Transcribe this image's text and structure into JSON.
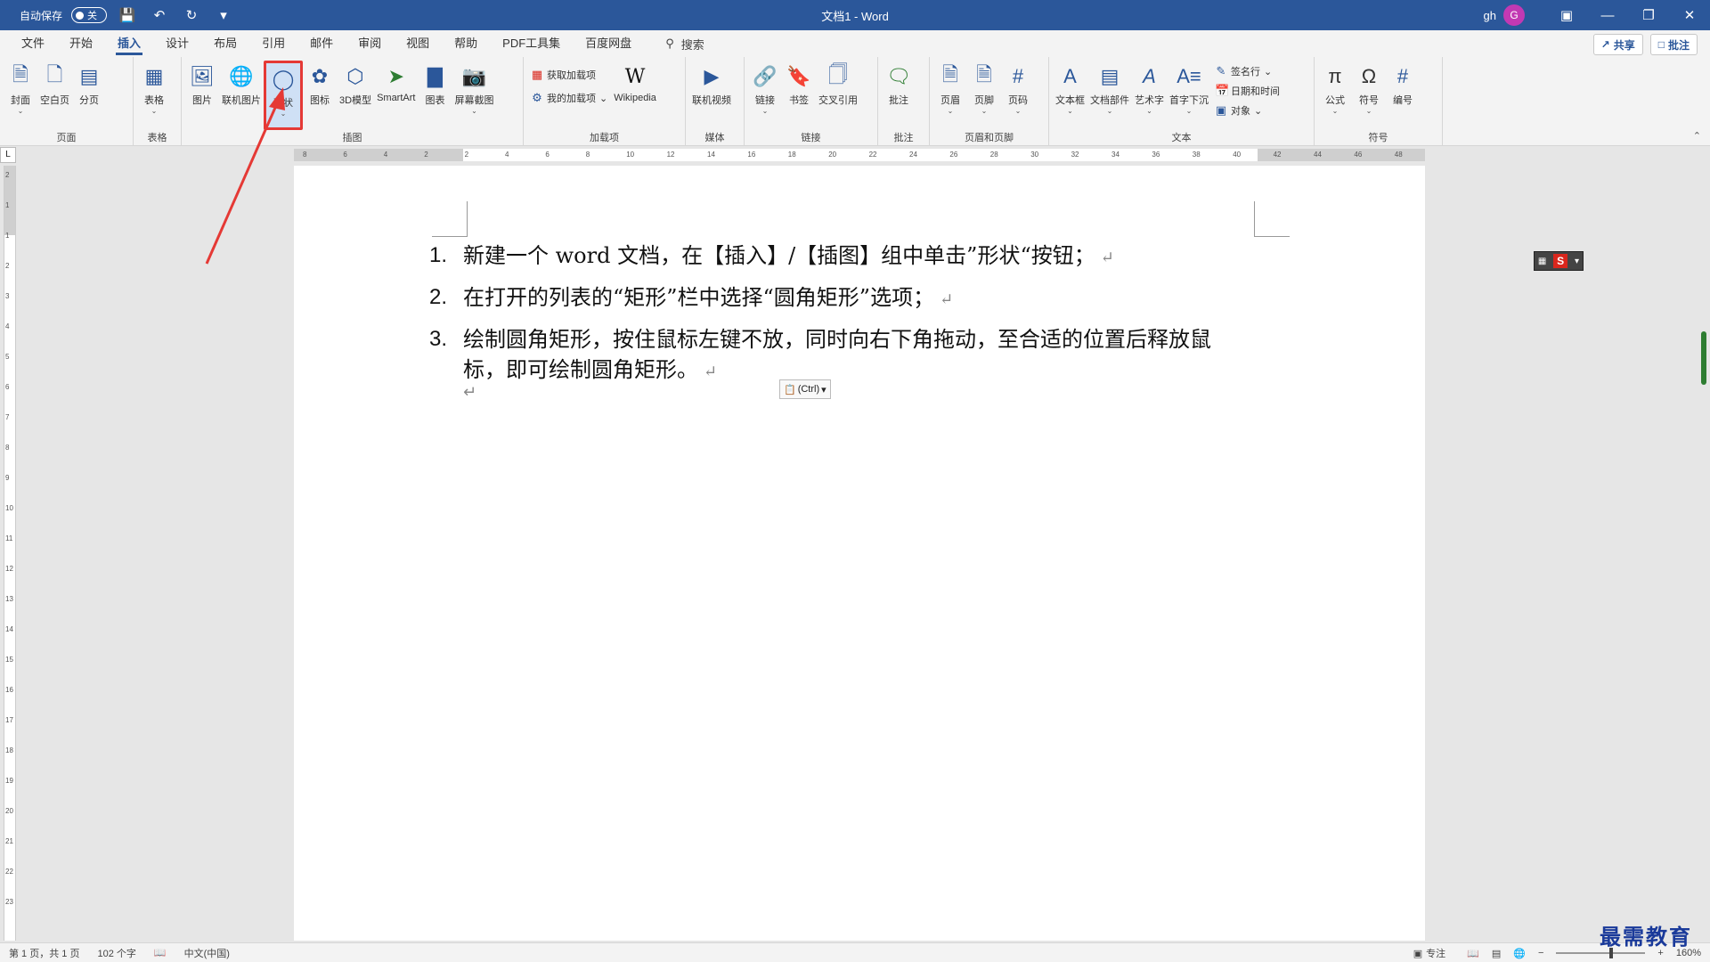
{
  "titlebar": {
    "autosave_label": "自动保存",
    "autosave_state": "关",
    "title": "文档1 - Word",
    "user": "gh",
    "avatar_letter": "G"
  },
  "menubar": {
    "tabs": [
      "文件",
      "开始",
      "插入",
      "设计",
      "布局",
      "引用",
      "邮件",
      "审阅",
      "视图",
      "帮助",
      "PDF工具集",
      "百度网盘"
    ],
    "active_tab": "插入",
    "search_label": "搜索",
    "share_label": "共享",
    "comment_label": "批注"
  },
  "ribbon": {
    "groups": {
      "pages": {
        "label": "页面",
        "buttons": [
          "封面",
          "空白页",
          "分页"
        ]
      },
      "table": {
        "label": "表格",
        "buttons": [
          "表格"
        ]
      },
      "illustrations": {
        "label": "插图",
        "buttons": [
          "图片",
          "联机图片",
          "形状",
          "图标",
          "3D模型",
          "SmartArt",
          "图表",
          "屏幕截图"
        ]
      },
      "addins": {
        "label": "加载项",
        "get": "获取加载项",
        "mine": "我的加载项",
        "wikipedia": "Wikipedia"
      },
      "media": {
        "label": "媒体",
        "buttons": [
          "联机视频"
        ]
      },
      "links": {
        "label": "链接",
        "buttons": [
          "链接",
          "书签",
          "交叉引用"
        ]
      },
      "comments": {
        "label": "批注",
        "buttons": [
          "批注"
        ]
      },
      "headerfooter": {
        "label": "页眉和页脚",
        "buttons": [
          "页眉",
          "页脚",
          "页码"
        ]
      },
      "text": {
        "label": "文本",
        "buttons": [
          "文本框",
          "文档部件",
          "艺术字",
          "首字下沉"
        ],
        "small": [
          "签名行",
          "日期和时间",
          "对象"
        ]
      },
      "symbols": {
        "label": "符号",
        "buttons": [
          "公式",
          "符号",
          "编号"
        ]
      }
    }
  },
  "document": {
    "items": [
      {
        "num": "1.",
        "text": "新建一个 word 文档，在【插入】/【插图】组中单击”形状“按钮；"
      },
      {
        "num": "2.",
        "text": "在打开的列表的“矩形”栏中选择“圆角矩形”选项；"
      },
      {
        "num": "3.",
        "text": "绘制圆角矩形，按住鼠标左键不放，同时向右下角拖动，至合适的位置后释放鼠标，即可绘制圆角矩形。"
      }
    ],
    "paste_label": "(Ctrl)"
  },
  "ruler": {
    "h_ticks": [
      "8",
      "6",
      "4",
      "2",
      "2",
      "4",
      "6",
      "8",
      "10",
      "12",
      "14",
      "16",
      "18",
      "20",
      "22",
      "24",
      "26",
      "28",
      "30",
      "32",
      "34",
      "36",
      "38",
      "40",
      "42",
      "44",
      "46",
      "48"
    ],
    "v_ticks": [
      "2",
      "1",
      "1",
      "2",
      "3",
      "4",
      "5",
      "6",
      "7",
      "8",
      "9",
      "10",
      "11",
      "12",
      "13",
      "14",
      "15",
      "16",
      "17",
      "18",
      "19",
      "20",
      "21",
      "22",
      "23"
    ]
  },
  "statusbar": {
    "page": "第 1 页，共 1 页",
    "words": "102 个字",
    "language": "中文(中国)",
    "focus": "专注",
    "zoom": "160%"
  },
  "watermark": "最需教育",
  "colors": {
    "accent": "#2b579a",
    "highlight": "#e53935"
  }
}
